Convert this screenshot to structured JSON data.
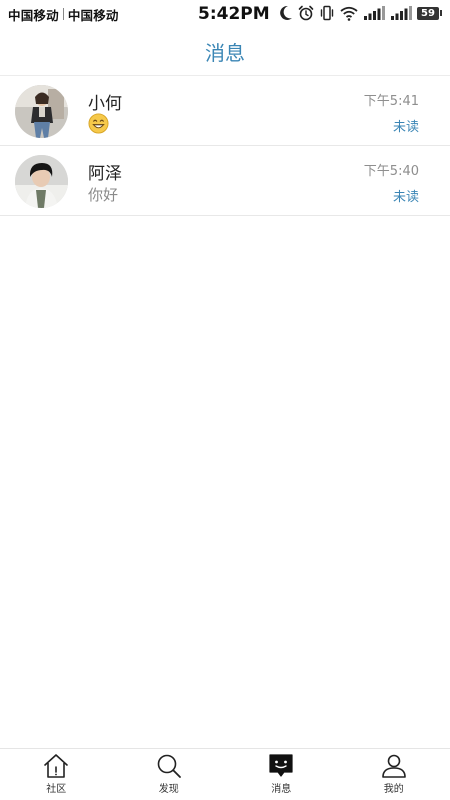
{
  "status_bar": {
    "carrier_1": "中国移动",
    "carrier_2": "中国移动",
    "time": "5:42PM",
    "battery": "59",
    "icons": [
      "moon-icon",
      "alarm-icon",
      "vibrate-icon",
      "wifi-icon",
      "signal-icon",
      "signal-icon",
      "battery-icon"
    ]
  },
  "header": {
    "title": "消息"
  },
  "conversations": [
    {
      "name": "小何",
      "preview": "",
      "preview_icon": "grinning-emoji-icon",
      "time": "下午5:41",
      "status": "未读"
    },
    {
      "name": "阿泽",
      "preview": "你好",
      "time": "下午5:40",
      "status": "未读"
    }
  ],
  "tabs": [
    {
      "label": "社区",
      "icon": "home-icon",
      "active": false
    },
    {
      "label": "发现",
      "icon": "search-icon",
      "active": false
    },
    {
      "label": "消息",
      "icon": "message-icon",
      "active": true
    },
    {
      "label": "我的",
      "icon": "user-icon",
      "active": false
    }
  ],
  "colors": {
    "accent": "#3b86b5",
    "muted_text": "#8a8a8a",
    "divider": "#e8e8e8"
  }
}
